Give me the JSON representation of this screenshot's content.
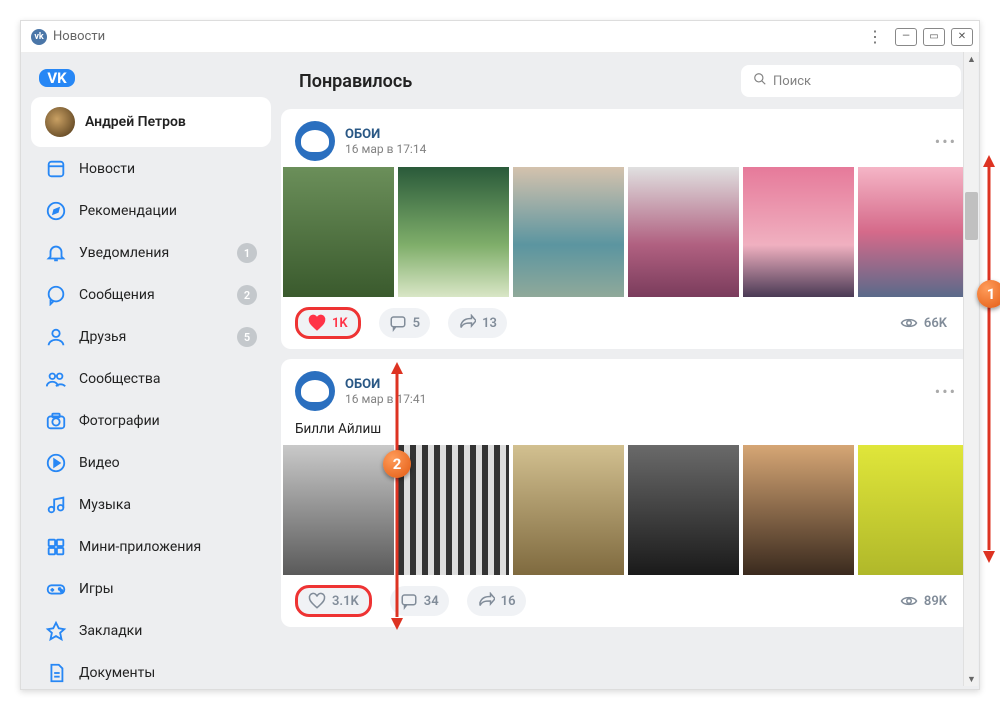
{
  "window": {
    "title": "Новости"
  },
  "header": {
    "page_title": "Понравилось",
    "search_placeholder": "Поиск"
  },
  "profile": {
    "name": "Андрей Петров"
  },
  "nav": [
    {
      "id": "news",
      "label": "Новости",
      "badge": null
    },
    {
      "id": "recommendations",
      "label": "Рекомендации",
      "badge": null
    },
    {
      "id": "notifications",
      "label": "Уведомления",
      "badge": "1"
    },
    {
      "id": "messages",
      "label": "Сообщения",
      "badge": "2"
    },
    {
      "id": "friends",
      "label": "Друзья",
      "badge": "5"
    },
    {
      "id": "communities",
      "label": "Сообщества",
      "badge": null
    },
    {
      "id": "photos",
      "label": "Фотографии",
      "badge": null
    },
    {
      "id": "video",
      "label": "Видео",
      "badge": null
    },
    {
      "id": "music",
      "label": "Музыка",
      "badge": null
    },
    {
      "id": "miniapps",
      "label": "Мини-приложения",
      "badge": null
    },
    {
      "id": "games",
      "label": "Игры",
      "badge": null
    },
    {
      "id": "bookmarks",
      "label": "Закладки",
      "badge": null
    },
    {
      "id": "documents",
      "label": "Документы",
      "badge": null
    }
  ],
  "posts": [
    {
      "author": "ОБОИ",
      "date": "16 мар в 17:14",
      "text": null,
      "likes": "1K",
      "liked": true,
      "comments": "5",
      "shares": "13",
      "views": "66K",
      "highlight_like": true
    },
    {
      "author": "ОБОИ",
      "date": "16 мар в 17:41",
      "text": "Билли Айлиш",
      "likes": "3.1K",
      "liked": false,
      "comments": "34",
      "shares": "16",
      "views": "89K",
      "highlight_like": true
    }
  ],
  "annotations": {
    "marker1": "1",
    "marker2": "2"
  }
}
